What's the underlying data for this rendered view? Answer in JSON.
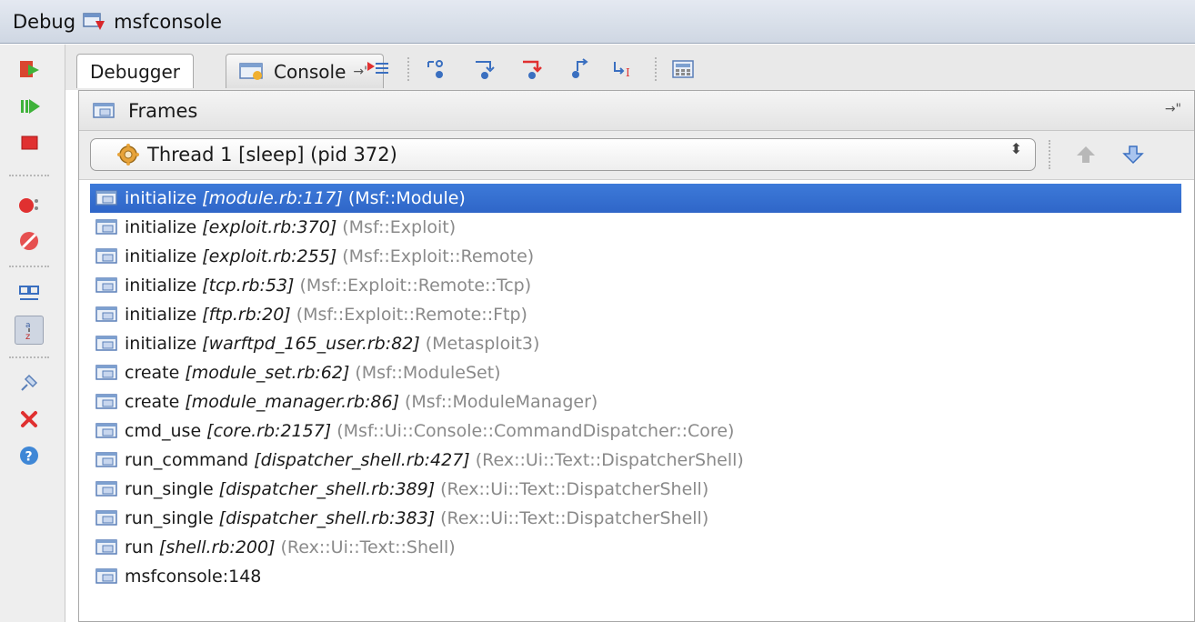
{
  "window": {
    "title_prefix": "Debug",
    "config_name": "msfconsole",
    "config_icon": "ruby-run-config-icon"
  },
  "left_toolbar": {
    "buttons": [
      {
        "name": "rerun-icon"
      },
      {
        "name": "resume-icon"
      },
      {
        "name": "stop-icon"
      },
      {
        "name": "view-breakpoints-icon"
      },
      {
        "name": "mute-breakpoints-icon"
      },
      {
        "name": "restore-layout-icon"
      },
      {
        "name": "sort-alphabetically-icon"
      },
      {
        "name": "pin-icon"
      },
      {
        "name": "close-icon"
      },
      {
        "name": "help-icon"
      }
    ]
  },
  "tabs": {
    "debugger_label": "Debugger",
    "console_label": "Console",
    "pin_glyph": "→\""
  },
  "step_toolbar": {
    "buttons": [
      {
        "name": "show-execution-point-icon"
      },
      {
        "name": "step-over-icon"
      },
      {
        "name": "step-into-icon"
      },
      {
        "name": "force-step-into-icon"
      },
      {
        "name": "step-out-icon"
      },
      {
        "name": "run-to-cursor-icon"
      },
      {
        "name": "evaluate-expression-icon"
      }
    ]
  },
  "frames_panel": {
    "title": "Frames",
    "pin_glyph": "→\"",
    "thread_selector": {
      "value": "Thread 1 [sleep] (pid 372)",
      "updown_glyph": "⬍"
    }
  },
  "frames": [
    {
      "method": "initialize",
      "location": "[module.rb:117]",
      "class": "(Msf::Module)",
      "selected": true
    },
    {
      "method": "initialize",
      "location": "[exploit.rb:370]",
      "class": "(Msf::Exploit)"
    },
    {
      "method": "initialize",
      "location": "[exploit.rb:255]",
      "class": "(Msf::Exploit::Remote)"
    },
    {
      "method": "initialize",
      "location": "[tcp.rb:53]",
      "class": "(Msf::Exploit::Remote::Tcp)"
    },
    {
      "method": "initialize",
      "location": "[ftp.rb:20]",
      "class": "(Msf::Exploit::Remote::Ftp)"
    },
    {
      "method": "initialize",
      "location": "[warftpd_165_user.rb:82]",
      "class": "(Metasploit3)"
    },
    {
      "method": "create",
      "location": "[module_set.rb:62]",
      "class": "(Msf::ModuleSet)"
    },
    {
      "method": "create",
      "location": "[module_manager.rb:86]",
      "class": "(Msf::ModuleManager)"
    },
    {
      "method": "cmd_use",
      "location": "[core.rb:2157]",
      "class": "(Msf::Ui::Console::CommandDispatcher::Core)"
    },
    {
      "method": "run_command",
      "location": "[dispatcher_shell.rb:427]",
      "class": "(Rex::Ui::Text::DispatcherShell)"
    },
    {
      "method": "run_single",
      "location": "[dispatcher_shell.rb:389]",
      "class": "(Rex::Ui::Text::DispatcherShell)"
    },
    {
      "method": "run_single",
      "location": "[dispatcher_shell.rb:383]",
      "class": "(Rex::Ui::Text::DispatcherShell)"
    },
    {
      "method": "run",
      "location": "[shell.rb:200]",
      "class": "(Rex::Ui::Text::Shell)"
    },
    {
      "method": "msfconsole:148",
      "location": "",
      "class": ""
    }
  ]
}
